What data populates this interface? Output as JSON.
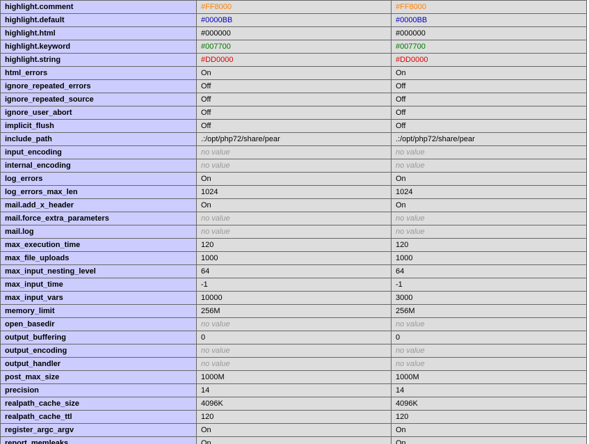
{
  "rows": [
    {
      "name": "highlight.comment",
      "local": "#FF8000",
      "master": "#FF8000",
      "color": "#FF8000",
      "no_value": false
    },
    {
      "name": "highlight.default",
      "local": "#0000BB",
      "master": "#0000BB",
      "color": "#0000BB",
      "no_value": false
    },
    {
      "name": "highlight.html",
      "local": "#000000",
      "master": "#000000",
      "color": "#000000",
      "no_value": false
    },
    {
      "name": "highlight.keyword",
      "local": "#007700",
      "master": "#007700",
      "color": "#007700",
      "no_value": false
    },
    {
      "name": "highlight.string",
      "local": "#DD0000",
      "master": "#DD0000",
      "color": "#DD0000",
      "no_value": false
    },
    {
      "name": "html_errors",
      "local": "On",
      "master": "On",
      "no_value": false
    },
    {
      "name": "ignore_repeated_errors",
      "local": "Off",
      "master": "Off",
      "no_value": false
    },
    {
      "name": "ignore_repeated_source",
      "local": "Off",
      "master": "Off",
      "no_value": false
    },
    {
      "name": "ignore_user_abort",
      "local": "Off",
      "master": "Off",
      "no_value": false
    },
    {
      "name": "implicit_flush",
      "local": "Off",
      "master": "Off",
      "no_value": false
    },
    {
      "name": "include_path",
      "local": ".:/opt/php72/share/pear",
      "master": ".:/opt/php72/share/pear",
      "no_value": false
    },
    {
      "name": "input_encoding",
      "local": "no value",
      "master": "no value",
      "no_value": true
    },
    {
      "name": "internal_encoding",
      "local": "no value",
      "master": "no value",
      "no_value": true
    },
    {
      "name": "log_errors",
      "local": "On",
      "master": "On",
      "no_value": false
    },
    {
      "name": "log_errors_max_len",
      "local": "1024",
      "master": "1024",
      "no_value": false
    },
    {
      "name": "mail.add_x_header",
      "local": "On",
      "master": "On",
      "no_value": false
    },
    {
      "name": "mail.force_extra_parameters",
      "local": "no value",
      "master": "no value",
      "no_value": true
    },
    {
      "name": "mail.log",
      "local": "no value",
      "master": "no value",
      "no_value": true
    },
    {
      "name": "max_execution_time",
      "local": "120",
      "master": "120",
      "no_value": false
    },
    {
      "name": "max_file_uploads",
      "local": "1000",
      "master": "1000",
      "no_value": false
    },
    {
      "name": "max_input_nesting_level",
      "local": "64",
      "master": "64",
      "no_value": false
    },
    {
      "name": "max_input_time",
      "local": "-1",
      "master": "-1",
      "no_value": false
    },
    {
      "name": "max_input_vars",
      "local": "10000",
      "master": "3000",
      "no_value": false
    },
    {
      "name": "memory_limit",
      "local": "256M",
      "master": "256M",
      "no_value": false
    },
    {
      "name": "open_basedir",
      "local": "no value",
      "master": "no value",
      "no_value": true
    },
    {
      "name": "output_buffering",
      "local": "0",
      "master": "0",
      "no_value": false
    },
    {
      "name": "output_encoding",
      "local": "no value",
      "master": "no value",
      "no_value": true
    },
    {
      "name": "output_handler",
      "local": "no value",
      "master": "no value",
      "no_value": true
    },
    {
      "name": "post_max_size",
      "local": "1000M",
      "master": "1000M",
      "no_value": false
    },
    {
      "name": "precision",
      "local": "14",
      "master": "14",
      "no_value": false
    },
    {
      "name": "realpath_cache_size",
      "local": "4096K",
      "master": "4096K",
      "no_value": false
    },
    {
      "name": "realpath_cache_ttl",
      "local": "120",
      "master": "120",
      "no_value": false
    },
    {
      "name": "register_argc_argv",
      "local": "On",
      "master": "On",
      "no_value": false
    },
    {
      "name": "report_memleaks",
      "local": "On",
      "master": "On",
      "no_value": false
    }
  ]
}
